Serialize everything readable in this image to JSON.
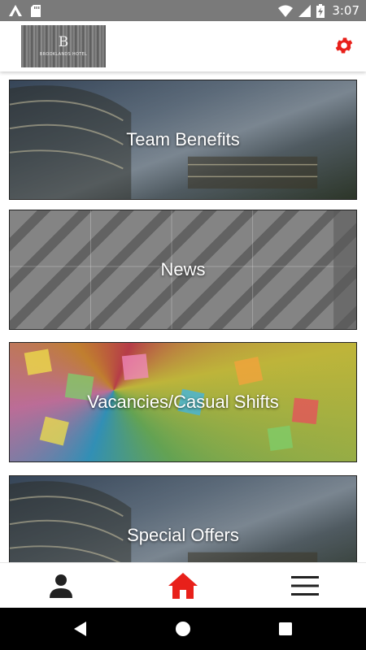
{
  "status_bar": {
    "time": "3:07",
    "icons": [
      "a-icon",
      "sd-card-icon",
      "wifi-icon",
      "signal-icon",
      "battery-charging-icon"
    ]
  },
  "header": {
    "logo": {
      "mark": "B",
      "name": "BROOKLANDS HOTEL"
    },
    "settings_icon": "gear-icon",
    "accent_color": "#e8201a"
  },
  "cards": [
    {
      "label": "Team Benefits"
    },
    {
      "label": "News"
    },
    {
      "label": "Vacancies/Casual Shifts"
    },
    {
      "label": "Special Offers"
    }
  ],
  "tab_bar": {
    "items": [
      {
        "icon": "person-icon",
        "active": false
      },
      {
        "icon": "home-icon",
        "active": true
      },
      {
        "icon": "hamburger-menu-icon",
        "active": false
      }
    ]
  },
  "nav_bar": {
    "icons": [
      "back-icon",
      "home-circle-icon",
      "recents-icon"
    ]
  }
}
